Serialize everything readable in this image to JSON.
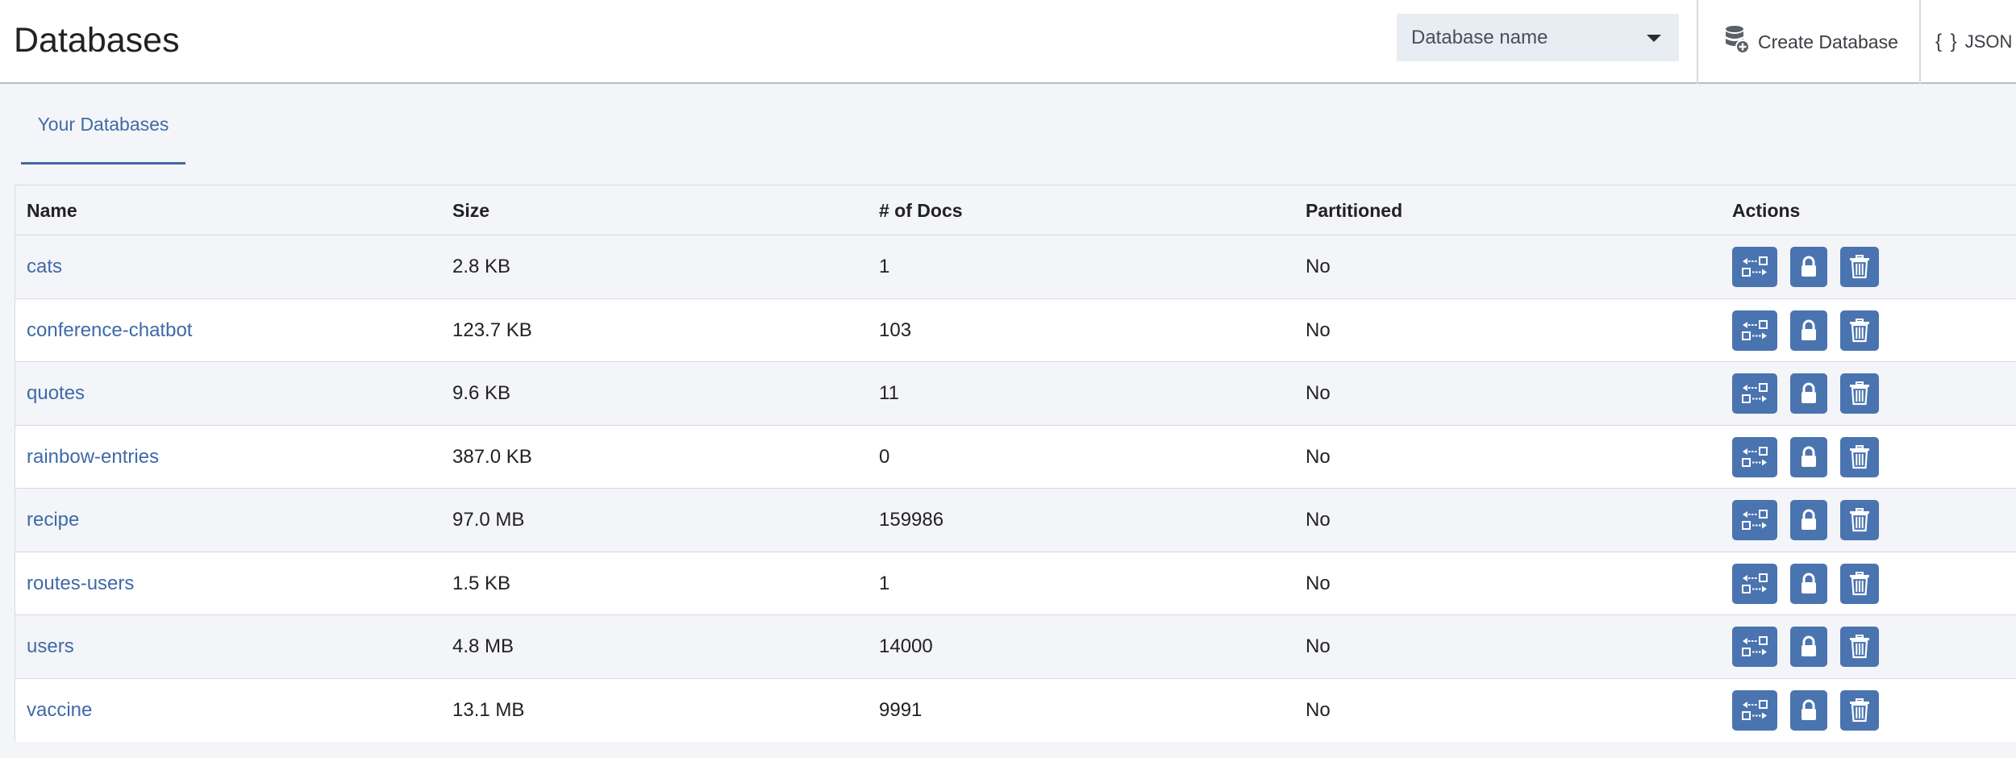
{
  "header": {
    "title": "Databases",
    "search_placeholder": "Database name",
    "create_label": "Create Database",
    "json_braces": "{ }",
    "json_label": "JSON"
  },
  "tabs": [
    {
      "label": "Your Databases",
      "active": true
    }
  ],
  "table": {
    "columns": [
      "Name",
      "Size",
      "# of Docs",
      "Partitioned",
      "Actions"
    ],
    "rows": [
      {
        "name": "cats",
        "size": "2.8 KB",
        "docs": "1",
        "partitioned": "No"
      },
      {
        "name": "conference-chatbot",
        "size": "123.7 KB",
        "docs": "103",
        "partitioned": "No"
      },
      {
        "name": "quotes",
        "size": "9.6 KB",
        "docs": "11",
        "partitioned": "No"
      },
      {
        "name": "rainbow-entries",
        "size": "387.0 KB",
        "docs": "0",
        "partitioned": "No"
      },
      {
        "name": "recipe",
        "size": "97.0 MB",
        "docs": "159986",
        "partitioned": "No"
      },
      {
        "name": "routes-users",
        "size": "1.5 KB",
        "docs": "1",
        "partitioned": "No"
      },
      {
        "name": "users",
        "size": "4.8 MB",
        "docs": "14000",
        "partitioned": "No"
      },
      {
        "name": "vaccine",
        "size": "13.1 MB",
        "docs": "9991",
        "partitioned": "No"
      }
    ],
    "row_actions": [
      "replicate-icon",
      "lock-icon",
      "trash-icon"
    ]
  },
  "colors": {
    "accent": "#3f6aa8",
    "action_button": "#4a74b0"
  }
}
